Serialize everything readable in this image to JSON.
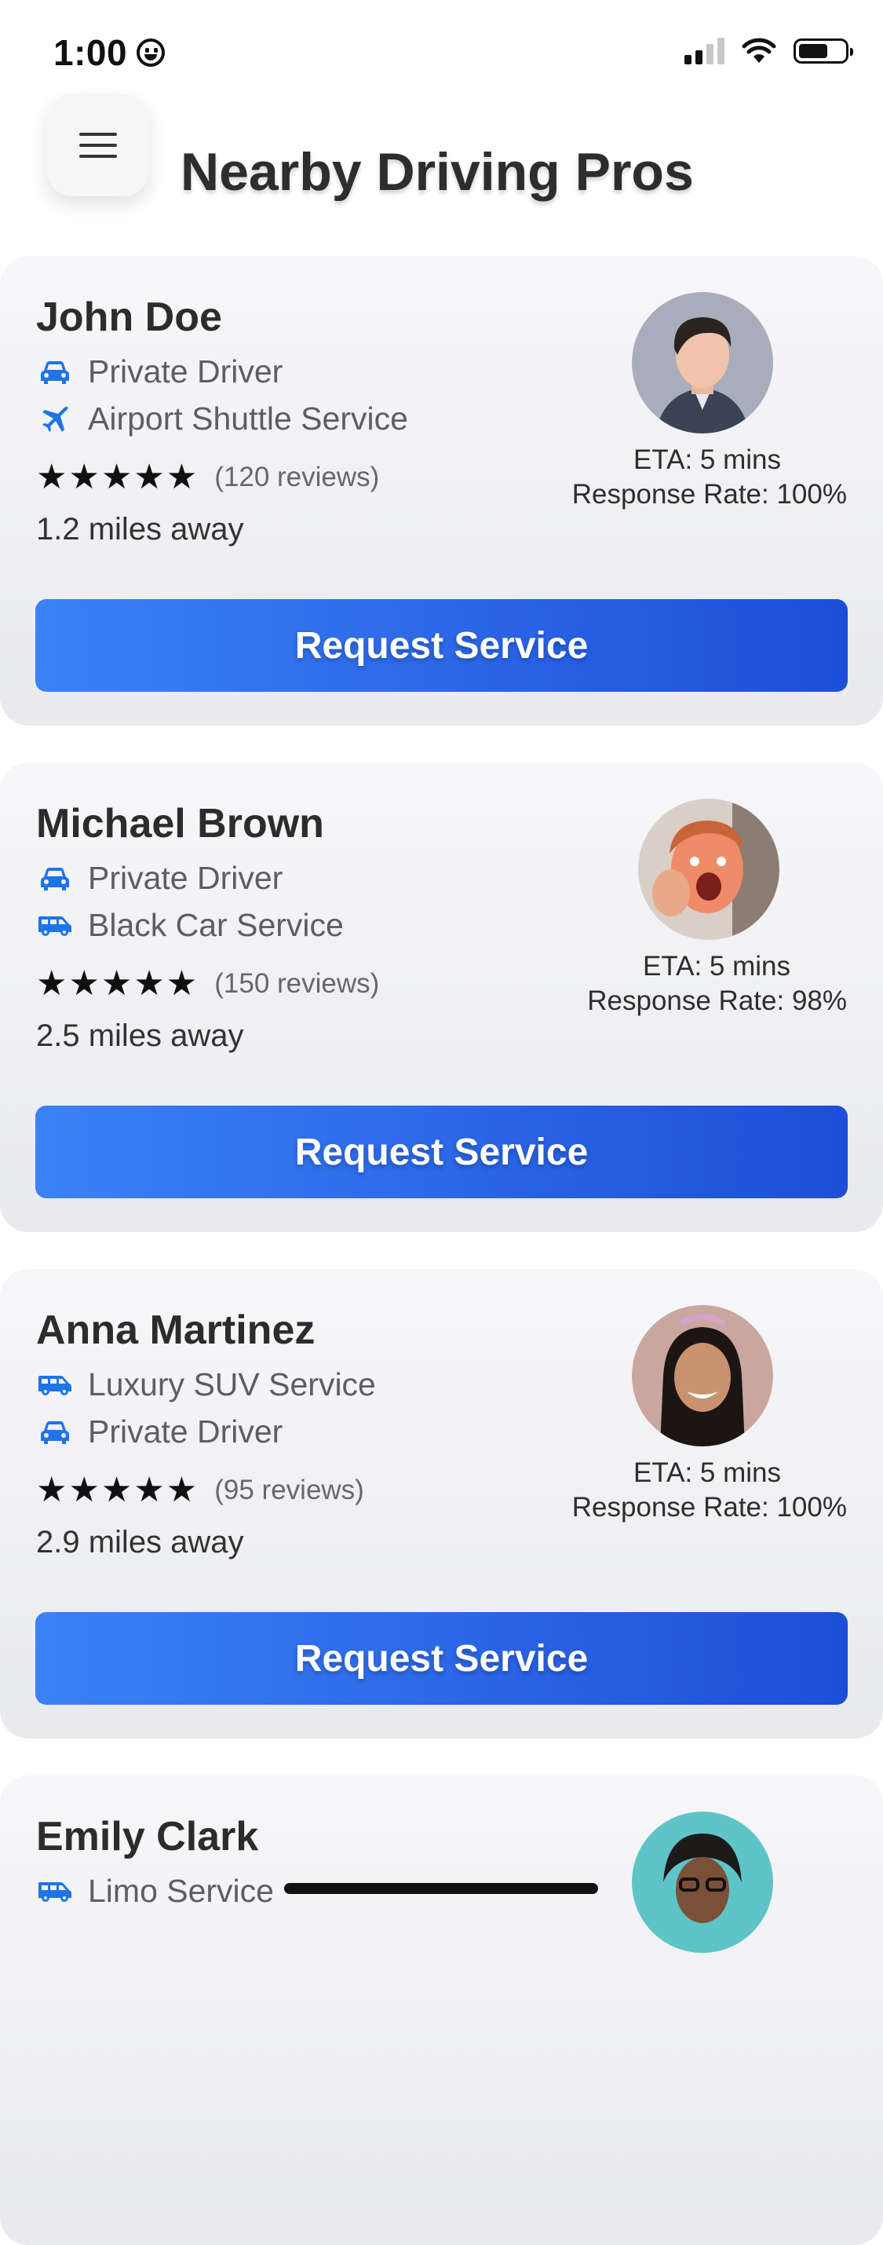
{
  "status_bar": {
    "time": "1:00"
  },
  "header": {
    "title": "Nearby Driving Pros"
  },
  "drivers": [
    {
      "name": "John Doe",
      "services": [
        {
          "label": "Private Driver",
          "icon": "car-icon"
        },
        {
          "label": "Airport Shuttle Service",
          "icon": "airplane-icon"
        }
      ],
      "stars": "★★★★★",
      "reviews": "(120 reviews)",
      "distance": "1.2 miles away",
      "eta": "ETA: 5 mins",
      "response_rate": "Response Rate: 100%",
      "button": "Request Service"
    },
    {
      "name": "Michael Brown",
      "services": [
        {
          "label": "Private Driver",
          "icon": "car-icon"
        },
        {
          "label": "Black Car Service",
          "icon": "van-icon"
        }
      ],
      "stars": "★★★★★",
      "reviews": "(150 reviews)",
      "distance": "2.5 miles away",
      "eta": "ETA: 5 mins",
      "response_rate": "Response Rate: 98%",
      "button": "Request Service"
    },
    {
      "name": "Anna Martinez",
      "services": [
        {
          "label": "Luxury SUV Service",
          "icon": "van-icon"
        },
        {
          "label": "Private Driver",
          "icon": "car-icon"
        }
      ],
      "stars": "★★★★★",
      "reviews": "(95 reviews)",
      "distance": "2.9 miles away",
      "eta": "ETA: 5 mins",
      "response_rate": "Response Rate: 100%",
      "button": "Request Service"
    },
    {
      "name": "Emily Clark",
      "services": [
        {
          "label": "Limo Service",
          "icon": "van-icon"
        }
      ]
    }
  ],
  "colors": {
    "accent": "#2563eb",
    "accent_dark": "#1d4ed8",
    "icon": "#1e74e8"
  }
}
